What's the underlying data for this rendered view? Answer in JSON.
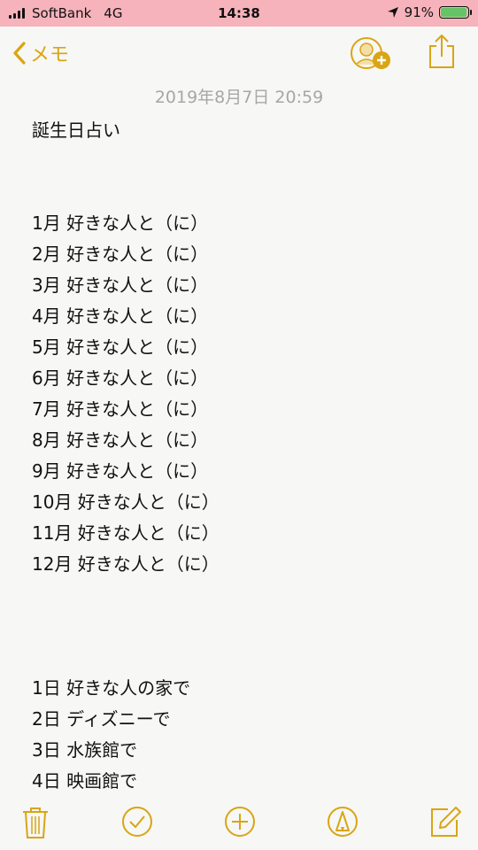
{
  "status_bar": {
    "carrier": "SoftBank",
    "network": "4G",
    "time": "14:38",
    "battery": "91%",
    "battery_level": 0.91
  },
  "nav": {
    "back_label": "メモ"
  },
  "note": {
    "date": "2019年8月7日 20:59",
    "title": "誕生日占い",
    "months": [
      "1月 好きな人と（に）",
      "2月 好きな人と（に）",
      "3月 好きな人と（に）",
      "4月 好きな人と（に）",
      "5月 好きな人と（に）",
      "6月 好きな人と（に）",
      "7月 好きな人と（に）",
      "8月 好きな人と（に）",
      "9月 好きな人と（に）",
      "10月 好きな人と（に）",
      "11月 好きな人と（に）",
      "12月 好きな人と（に）"
    ],
    "days": [
      "1日 好きな人の家で",
      "2日 ディズニーで",
      "3日 水族館で",
      "4日 映画館で"
    ]
  },
  "colors": {
    "accent": "#d9a514",
    "status_bar_bg": "#f6b3bb",
    "battery_fill": "#65c466"
  },
  "icons": [
    "back-chevron-icon",
    "add-person-icon",
    "share-icon",
    "trash-icon",
    "checklist-icon",
    "add-icon",
    "markup-icon",
    "compose-icon"
  ]
}
